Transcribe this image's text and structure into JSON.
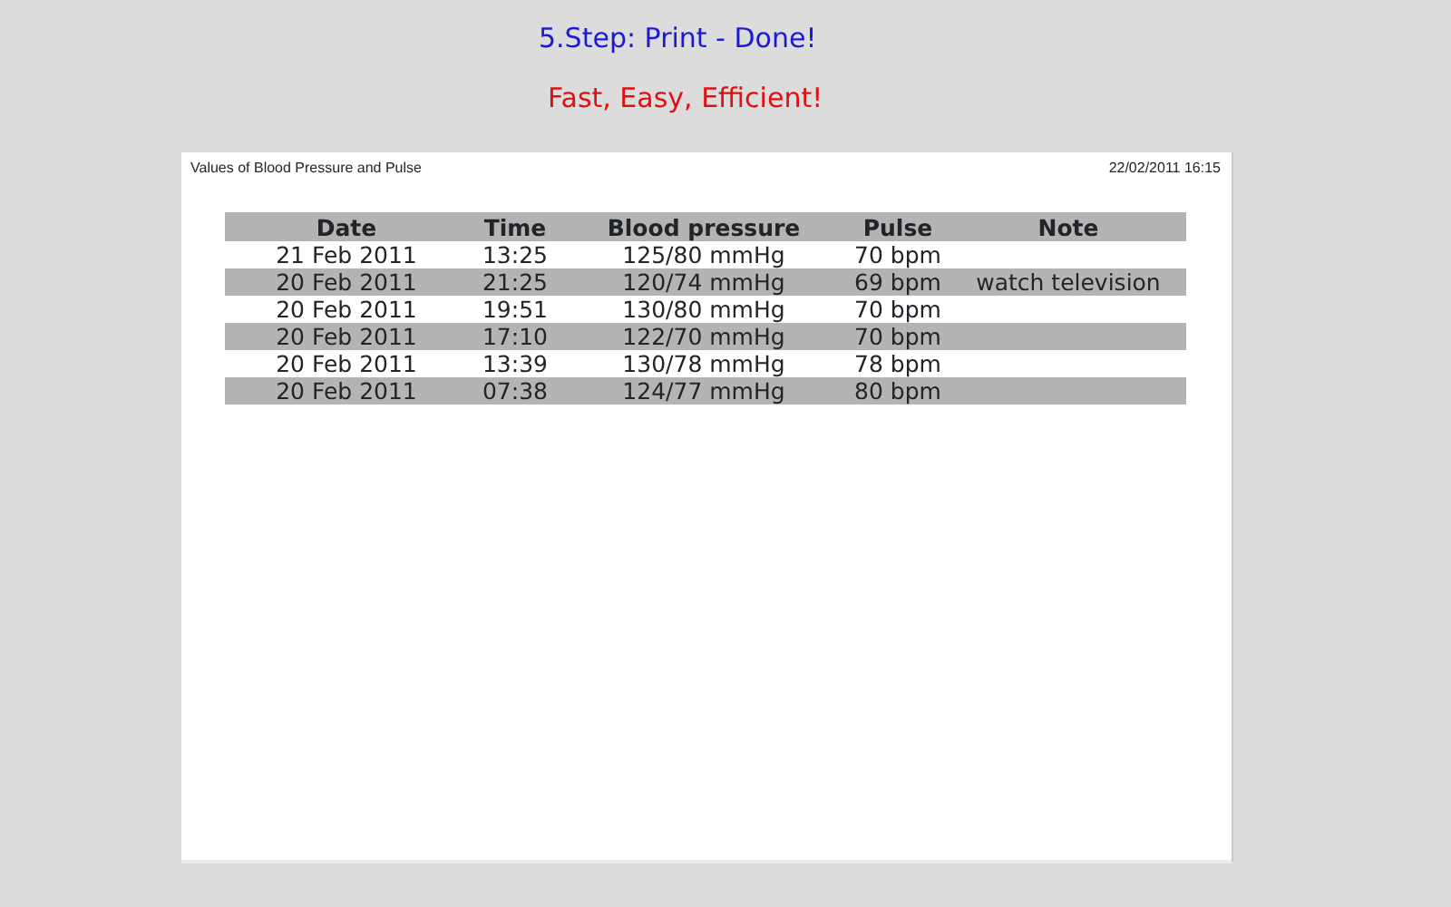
{
  "headline": "5.Step: Print - Done!",
  "slogan": "Fast, Easy, Efficient!",
  "document": {
    "title": "Values of Blood Pressure and Pulse",
    "printed_at": "22/02/2011 16:15",
    "table": {
      "columns": [
        "Date",
        "Time",
        "Blood pressure",
        "Pulse",
        "Note"
      ],
      "rows": [
        [
          "21 Feb 2011",
          "13:25",
          "125/80 mmHg",
          "70 bpm",
          ""
        ],
        [
          "20 Feb 2011",
          "21:25",
          "120/74 mmHg",
          "69 bpm",
          "watch television"
        ],
        [
          "20 Feb 2011",
          "19:51",
          "130/80 mmHg",
          "70 bpm",
          ""
        ],
        [
          "20 Feb 2011",
          "17:10",
          "122/70 mmHg",
          "70 bpm",
          ""
        ],
        [
          "20 Feb 2011",
          "13:39",
          "130/78 mmHg",
          "78 bpm",
          ""
        ],
        [
          "20 Feb 2011",
          "07:38",
          "124/77 mmHg",
          "80 bpm",
          ""
        ]
      ]
    }
  }
}
